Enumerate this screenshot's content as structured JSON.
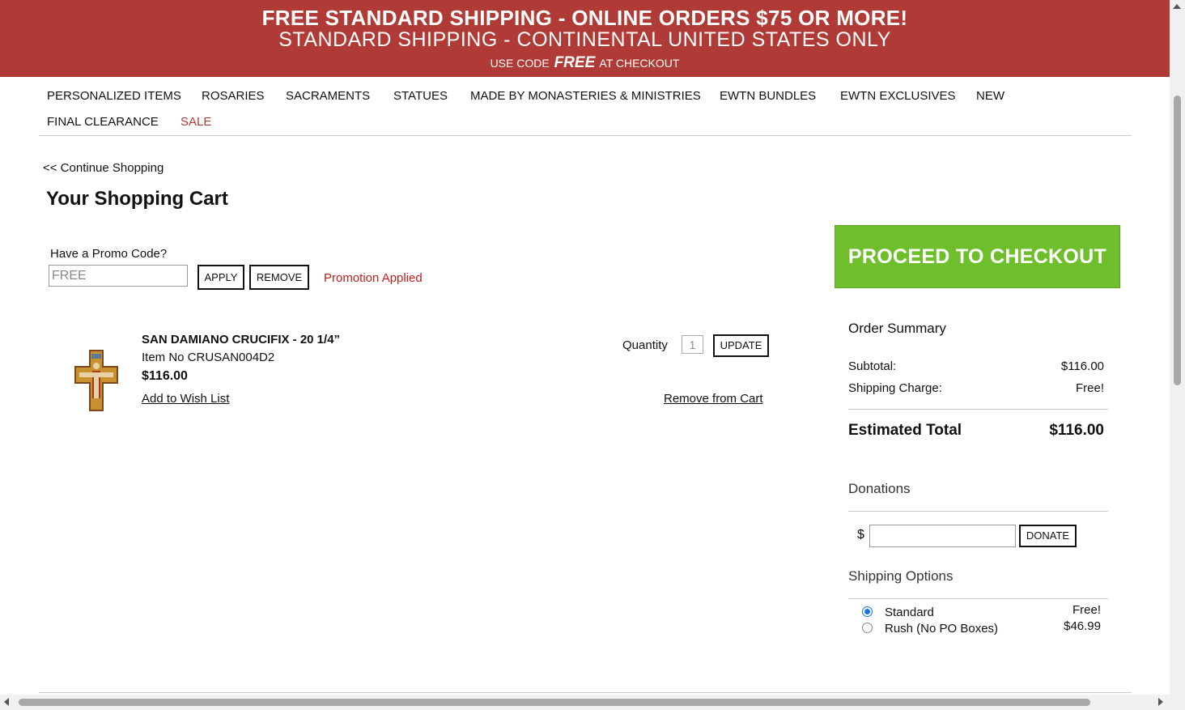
{
  "banner": {
    "line1": "FREE STANDARD SHIPPING - ONLINE ORDERS $75 OR MORE!",
    "line2": "STANDARD SHIPPING - CONTINENTAL UNITED STATES ONLY",
    "line3_pre": "USE CODE",
    "line3_code": "FREE",
    "line3_post": "AT CHECKOUT",
    "color": "#b03a35"
  },
  "nav": {
    "items": [
      "PERSONALIZED ITEMS",
      "ROSARIES",
      "SACRAMENTS",
      "STATUES",
      "MADE BY MONASTERIES & MINISTRIES",
      "EWTN BUNDLES",
      "EWTN EXCLUSIVES",
      "NEW",
      "FINAL CLEARANCE",
      "SALE"
    ]
  },
  "cart": {
    "continue_link": "<< Continue Shopping",
    "title": "Your Shopping Cart",
    "promo": {
      "label": "Have a Promo Code?",
      "value": "FREE",
      "apply_label": "APPLY",
      "remove_label": "REMOVE",
      "message": "Promotion Applied"
    },
    "item": {
      "name": "SAN DAMIANO CRUCIFIX - 20 1/4”",
      "item_no": "Item No CRUSAN004D2",
      "price": "$116.00",
      "wish_link": "Add to Wish List",
      "quantity_label": "Quantity",
      "quantity": "1",
      "update_label": "UPDATE",
      "remove_link": "Remove from Cart",
      "image_icon": "crucifix-icon"
    }
  },
  "checkout": {
    "button_label": "PROCEED TO CHECKOUT",
    "color": "#6fbf2d"
  },
  "summary": {
    "title": "Order Summary",
    "subtotal_label": "Subtotal:",
    "subtotal": "$116.00",
    "shipping_label": "Shipping Charge:",
    "shipping": "Free!",
    "total_label": "Estimated Total",
    "total": "$116.00"
  },
  "donations": {
    "title": "Donations",
    "currency": "$",
    "donate_label": "DONATE"
  },
  "shipping_options": {
    "title": "Shipping Options",
    "options": [
      {
        "label": "Standard",
        "price": "Free!",
        "selected": true
      },
      {
        "label": "Rush (No PO Boxes)",
        "price": "$46.99",
        "selected": false
      }
    ]
  }
}
